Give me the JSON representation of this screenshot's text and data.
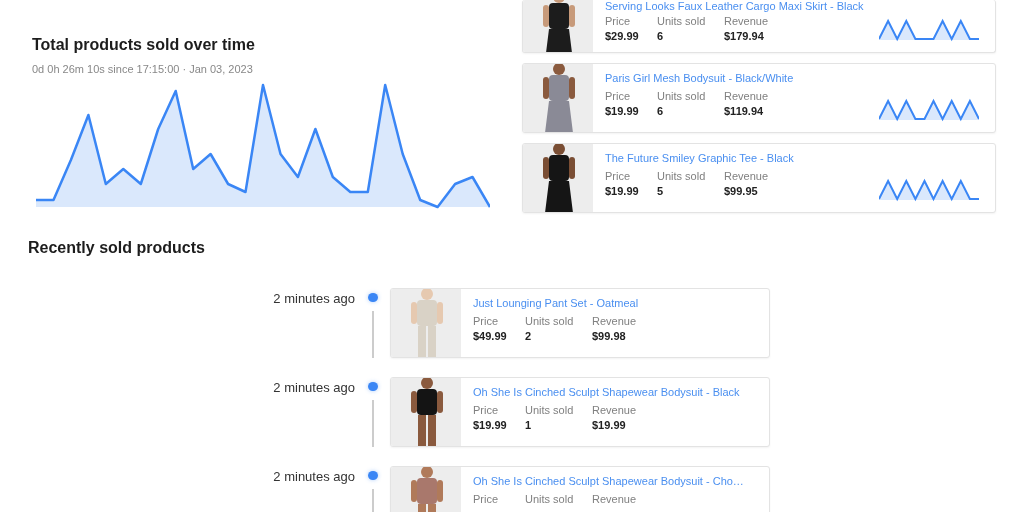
{
  "chart": {
    "title": "Total products sold over time",
    "subtitle": "0d 0h 26m 10s since 17:15:00 · Jan 03, 2023"
  },
  "top_products": [
    {
      "name": "Serving Looks Faux Leather Cargo Maxi Skirt - Black",
      "stats": [
        {
          "label": "Price",
          "value": "$29.99"
        },
        {
          "label": "Units sold",
          "value": "6"
        },
        {
          "label": "Revenue",
          "value": "$179.94"
        }
      ]
    },
    {
      "name": "Paris Girl Mesh Bodysuit - Black/White",
      "stats": [
        {
          "label": "Price",
          "value": "$19.99"
        },
        {
          "label": "Units sold",
          "value": "6"
        },
        {
          "label": "Revenue",
          "value": "$119.94"
        }
      ]
    },
    {
      "name": "The Future Smiley Graphic Tee - Black",
      "stats": [
        {
          "label": "Price",
          "value": "$19.99"
        },
        {
          "label": "Units sold",
          "value": "5"
        },
        {
          "label": "Revenue",
          "value": "$99.95"
        }
      ]
    }
  ],
  "recent": {
    "title": "Recently sold products",
    "items": [
      {
        "time": "2 minutes ago",
        "name": "Just Lounging Pant Set - Oatmeal",
        "stats": [
          {
            "label": "Price",
            "value": "$49.99"
          },
          {
            "label": "Units sold",
            "value": "2"
          },
          {
            "label": "Revenue",
            "value": "$99.98"
          }
        ]
      },
      {
        "time": "2 minutes ago",
        "name": "Oh She Is Cinched Sculpt Shapewear Bodysuit - Black",
        "stats": [
          {
            "label": "Price",
            "value": "$19.99"
          },
          {
            "label": "Units sold",
            "value": "1"
          },
          {
            "label": "Revenue",
            "value": "$19.99"
          }
        ]
      },
      {
        "time": "2 minutes ago",
        "name": "Oh She Is Cinched Sculpt Shapewear Bodysuit - Cho…",
        "stats": [
          {
            "label": "Price"
          },
          {
            "label": "Units sold"
          },
          {
            "label": "Revenue"
          }
        ]
      }
    ]
  }
}
